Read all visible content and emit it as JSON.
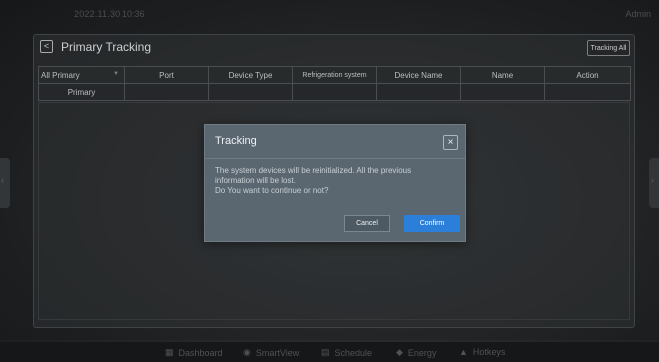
{
  "topbar": {
    "date": "2022.11.30",
    "time": "10:36",
    "user": "Admin"
  },
  "page": {
    "title": "Primary Tracking",
    "back_icon": "chevron-left-icon",
    "tracking_all_label": "Tracking All"
  },
  "table": {
    "filter_value": "All Primary",
    "headers": [
      "Port",
      "Device Type",
      "Refrigeration system",
      "Device Name",
      "Name",
      "Action"
    ],
    "rows": [
      {
        "type": "Primary"
      }
    ]
  },
  "dialog": {
    "title": "Tracking",
    "close_icon": "close-icon",
    "message_line1": "The system devices will be reinitialized. All the previous",
    "message_line2": "information will be lost.",
    "message_line3": "Do You want to continue or not?",
    "cancel_label": "Cancel",
    "confirm_label": "Confirm"
  },
  "bottom_nav": [
    {
      "label": "Dashboard",
      "icon": "dashboard-icon"
    },
    {
      "label": "SmartView",
      "icon": "smartview-icon"
    },
    {
      "label": "Schedule",
      "icon": "schedule-icon"
    },
    {
      "label": "Energy",
      "icon": "energy-icon"
    },
    {
      "label": "Hotkeys",
      "icon": "hotkeys-icon"
    }
  ],
  "colors": {
    "accent": "#2b7fd8",
    "dialog_bg": "#5a6670",
    "background": "#1f2123"
  }
}
